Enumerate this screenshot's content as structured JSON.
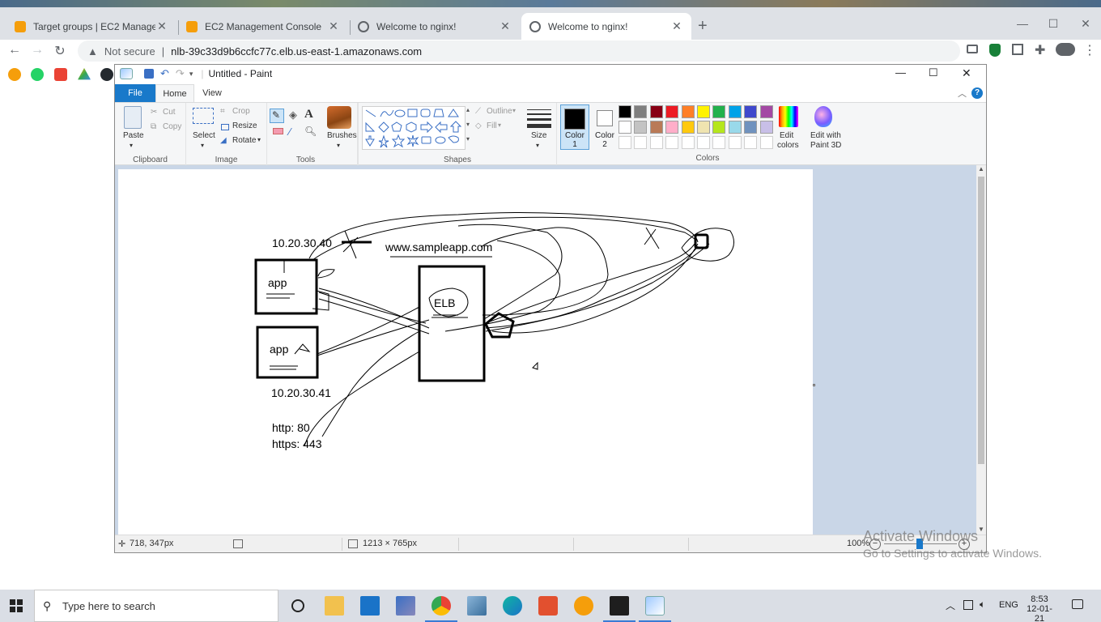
{
  "browser": {
    "tabs": [
      {
        "title": "Target groups | EC2 Management Console",
        "favicon": "aws-icon"
      },
      {
        "title": "EC2 Management Console",
        "favicon": "aws-icon"
      },
      {
        "title": "Welcome to nginx!",
        "favicon": "globe-icon"
      },
      {
        "title": "Welcome to nginx!",
        "favicon": "globe-icon"
      }
    ],
    "new_tab": "+",
    "security": "Not secure",
    "url": "nlb-39c33d9b6ccfc77c.elb.us-east-1.amazonaws.com"
  },
  "paint": {
    "title": "Untitled - Paint",
    "tabs": {
      "file": "File",
      "home": "Home",
      "view": "View"
    },
    "clipboard": {
      "paste": "Paste",
      "cut": "Cut",
      "copy": "Copy",
      "label": "Clipboard"
    },
    "image": {
      "select": "Select",
      "crop": "Crop",
      "resize": "Resize",
      "rotate": "Rotate",
      "label": "Image"
    },
    "tools": {
      "label": "Tools"
    },
    "brushes": "Brushes",
    "shapes": {
      "outline": "Outline",
      "fill": "Fill",
      "label": "Shapes"
    },
    "size": "Size",
    "color1": {
      "line1": "Color",
      "line2": "1"
    },
    "color2": {
      "line1": "Color",
      "line2": "2"
    },
    "colors_label": "Colors",
    "edit_colors": {
      "line1": "Edit",
      "line2": "colors"
    },
    "edit_paint3d": {
      "line1": "Edit with",
      "line2": "Paint 3D"
    },
    "palette_row1": [
      "#000000",
      "#7f7f7f",
      "#880015",
      "#ed1c24",
      "#ff7f27",
      "#fff200",
      "#22b14c",
      "#00a2e8",
      "#3f48cc",
      "#a349a4"
    ],
    "palette_row2": [
      "#ffffff",
      "#c3c3c3",
      "#b97a57",
      "#ffaec9",
      "#ffc90e",
      "#efe4b0",
      "#b5e61d",
      "#99d9ea",
      "#7092be",
      "#c8bfe7"
    ],
    "status": {
      "cursor": "718, 347px",
      "canvas_size": "1213 × 765px",
      "zoom": "100%"
    }
  },
  "drawing": {
    "ip1": "10.20.30.40",
    "ip2": "10.20.30.41",
    "domain": "www.sampleapp.com",
    "app1": "app",
    "app2": "app",
    "elb": "ELB",
    "http": "http: 80",
    "https": "https: 443"
  },
  "watermark": {
    "line1": "Activate Windows",
    "line2": "Go to Settings to activate Windows."
  },
  "taskbar": {
    "search_placeholder": "Type here to search",
    "lang": "ENG",
    "time": "8:53",
    "date": "12-01-21"
  }
}
